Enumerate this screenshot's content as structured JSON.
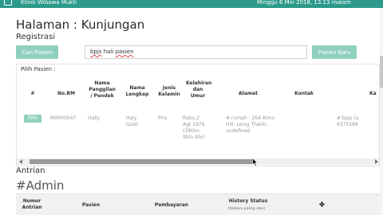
{
  "header": {
    "app_name": "Klinik Wibawa Mukti",
    "datetime": "Minggu 6 Mei 2018, 13.13 malam"
  },
  "page": {
    "title": "Halaman : Kunjungan",
    "section": "Registrasi"
  },
  "search": {
    "button_label": "Cari Pasien",
    "value_words": [
      "bpjs",
      "hali",
      "pasien"
    ],
    "new_patient_label": "Pasien Baru"
  },
  "patient_table": {
    "caption": "Pilih Pasien :",
    "columns": [
      "#",
      "No.RM",
      "Nama Panggilan / Pendek",
      "Nama Lengkap",
      "Jenis Kelamin",
      "Kelahiran dan Umur",
      "Alamat",
      "Kontak",
      "Ka"
    ],
    "rows": [
      {
        "action": "Pilih",
        "no_rm": "RM000047",
        "nama_panggilan": "Hally",
        "nama_lengkap": "Haly Iszell",
        "jenis_kelamin": "Pria",
        "kelahiran": "Rabu,2 Agt 1978 (39thn-9bln-4hr)",
        "alamat": "# rumah : 264 Almo Hill, Lenig Thành, undefined",
        "kontak": "",
        "ka": "# bpjs (a 6375589"
      }
    ]
  },
  "queue": {
    "title": "Antrian",
    "room": "#Admin",
    "columns": [
      "Nomor Antrian",
      "Pasien",
      "Pembayaran",
      "History Status"
    ],
    "history_sub": "(terbaru paling atas)"
  }
}
